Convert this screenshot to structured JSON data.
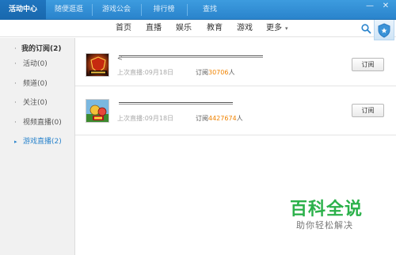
{
  "tabs": [
    {
      "label": "活动中心",
      "active": true
    },
    {
      "label": "随便逛逛",
      "active": false
    },
    {
      "label": "游戏公会",
      "active": false
    },
    {
      "label": "排行榜",
      "active": false
    },
    {
      "label": "查找",
      "active": false
    }
  ],
  "window": {
    "minimize": "—",
    "close": "✕"
  },
  "nav": {
    "items": [
      "首页",
      "直播",
      "娱乐",
      "教育",
      "游戏",
      "更多"
    ],
    "more_caret": "▾"
  },
  "sidebar": {
    "header": "我的订阅(2)",
    "items": [
      {
        "label": "活动(0)",
        "active": false
      },
      {
        "label": "频道(0)",
        "active": false
      },
      {
        "label": "关注(0)",
        "active": false
      },
      {
        "label": "视频直播(0)",
        "active": false
      },
      {
        "label": "游戏直播(2)",
        "active": true
      }
    ]
  },
  "channels": [
    {
      "title_prefix": "<",
      "last_live_label": "上次直播:09月18日",
      "sub_prefix": "订阅",
      "sub_count": "30706",
      "sub_suffix": "人",
      "button": "订阅"
    },
    {
      "title_prefix": "",
      "last_live_label": "上次直播:09月18日",
      "sub_prefix": "订阅",
      "sub_count": "4427674",
      "sub_suffix": "人",
      "button": "订阅"
    }
  ],
  "watermark": {
    "title": "百科全说",
    "subtitle": "助你轻松解决"
  },
  "colors": {
    "accent": "#2a84cc",
    "count": "#f08300",
    "brand_green": "#2bb14a"
  },
  "icons": {
    "search": "search-icon",
    "shield": "shield-icon"
  }
}
